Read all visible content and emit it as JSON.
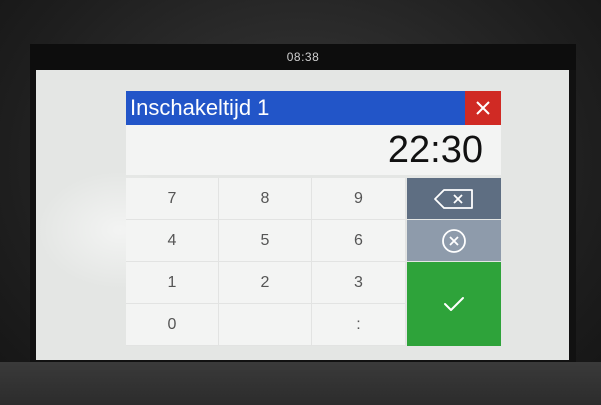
{
  "status_bar": {
    "time": "08:38"
  },
  "dialog": {
    "title": "Inschakeltijd  1",
    "value": "22:30"
  },
  "keypad": {
    "keys": [
      "7",
      "8",
      "9",
      "4",
      "5",
      "6",
      "1",
      "2",
      "3",
      "0",
      "",
      ":"
    ]
  },
  "colors": {
    "title_bar": "#2255c8",
    "close": "#d02a24",
    "backspace": "#5e6e82",
    "clear": "#8e9bab",
    "confirm": "#2ea33a"
  },
  "icons": {
    "close": "close-icon",
    "backspace": "backspace-icon",
    "clear": "clear-circle-x-icon",
    "confirm": "checkmark-icon"
  }
}
